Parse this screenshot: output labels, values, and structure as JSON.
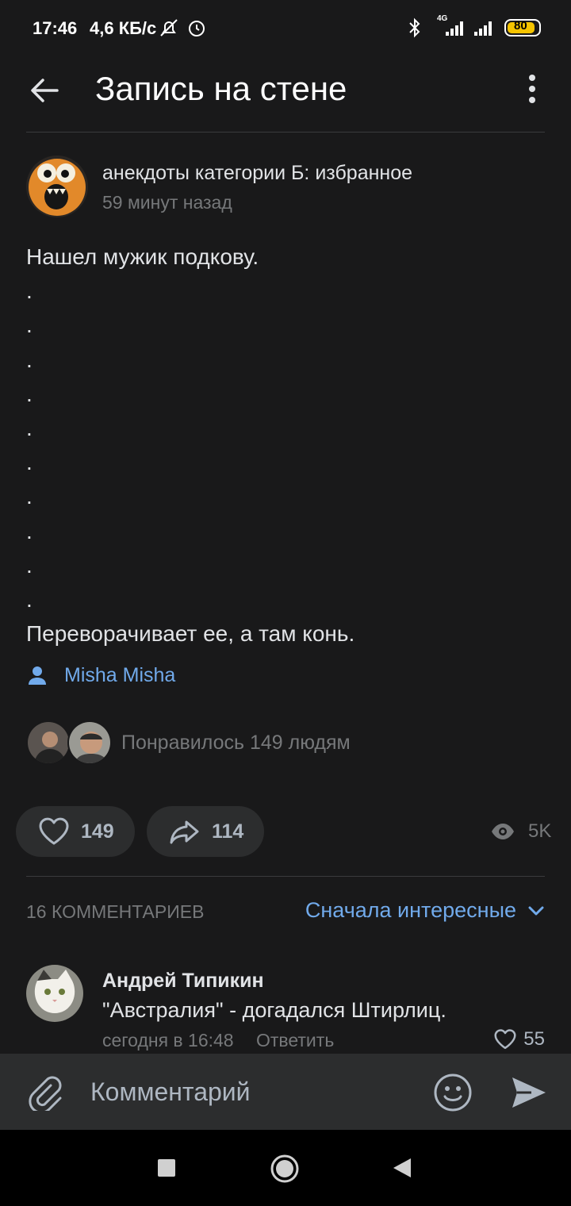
{
  "status_bar": {
    "time": "17:46",
    "speed": "4,6 КБ/с",
    "battery": "80",
    "network_label": "4G"
  },
  "header": {
    "title": "Запись на стене"
  },
  "post": {
    "author": "анекдоты категории Б: избранное",
    "time": "59 минут назад",
    "lines": [
      "Нашел мужик подкову.",
      ".",
      ".",
      ".",
      ".",
      ".",
      ".",
      ".",
      ".",
      ".",
      ".",
      "Переворачивает ее, а там конь."
    ],
    "signer": "Misha Misha",
    "liked_by": "Понравилось 149 людям",
    "likes_count": "149",
    "shares_count": "114",
    "views_count": "5K"
  },
  "comments": {
    "header": "16 КОММЕНТАРИЕВ",
    "sort_label": "Сначала интересные",
    "items": [
      {
        "name": "Андрей Типикин",
        "text": "\"Австралия\" - догадался Штирлиц.",
        "time": "сегодня в 16:48",
        "reply_label": "Ответить",
        "likes": "55"
      }
    ]
  },
  "composer": {
    "placeholder": "Комментарий"
  },
  "colors": {
    "background": "#19191a",
    "accent": "#71aaeb",
    "secondary_text": "#76787a",
    "panel": "#2c2d2e"
  },
  "icons": [
    "back-arrow-icon",
    "more-vertical-icon",
    "person-icon",
    "heart-icon",
    "share-icon",
    "eye-icon",
    "chevron-down-icon",
    "paperclip-icon",
    "emoji-icon",
    "send-icon",
    "nav-recents-icon",
    "nav-home-icon",
    "nav-back-icon"
  ]
}
